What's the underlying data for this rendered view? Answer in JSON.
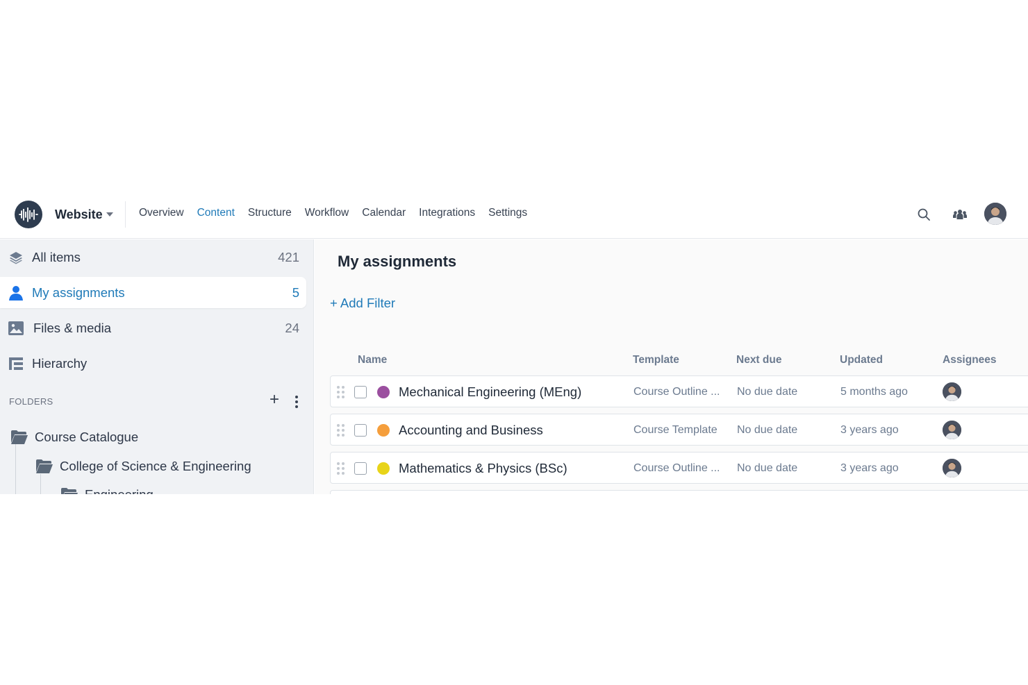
{
  "header": {
    "site_name": "Website",
    "nav": [
      "Overview",
      "Content",
      "Structure",
      "Workflow",
      "Calendar",
      "Integrations",
      "Settings"
    ],
    "active_nav": "Content"
  },
  "sidebar": {
    "items": [
      {
        "label": "All items",
        "count": "421",
        "icon": "layers-icon"
      },
      {
        "label": "My assignments",
        "count": "5",
        "icon": "user-icon"
      },
      {
        "label": "Files & media",
        "count": "24",
        "icon": "image-icon"
      },
      {
        "label": "Hierarchy",
        "count": "",
        "icon": "hierarchy-icon"
      }
    ],
    "folders_heading": "FOLDERS",
    "folder_add": "+",
    "tree": [
      {
        "label": "Course Catalogue"
      },
      {
        "label": "College of Science & Engineering"
      },
      {
        "label": "Engineering"
      }
    ]
  },
  "main": {
    "title": "My assignments",
    "add_filter": "+ Add Filter",
    "columns": [
      "Name",
      "Template",
      "Next due",
      "Updated",
      "Assignees"
    ],
    "rows": [
      {
        "name": "Mechanical Engineering (MEng)",
        "color": "#9b4f9f",
        "template": "Course Outline ...",
        "next_due": "No due date",
        "updated": "5 months ago"
      },
      {
        "name": "Accounting and Business",
        "color": "#f59e3c",
        "template": "Course Template",
        "next_due": "No due date",
        "updated": "3 years ago"
      },
      {
        "name": "Mathematics & Physics (BSc)",
        "color": "#e8d419",
        "template": "Course Outline ...",
        "next_due": "No due date",
        "updated": "3 years ago"
      }
    ]
  },
  "colors": {
    "accent": "#1f7ab8",
    "logo_bg": "#2e3c4f",
    "sidebar_bg": "#f0f2f5"
  }
}
